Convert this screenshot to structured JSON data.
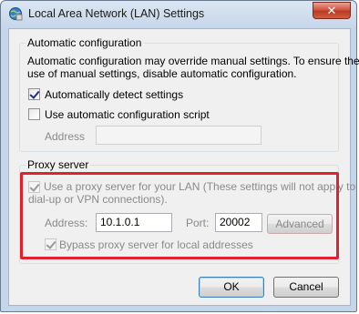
{
  "window": {
    "title": "Local Area Network (LAN) Settings",
    "close_glyph": "✕"
  },
  "auto_config": {
    "group_title": "Automatic configuration",
    "description_line1": "Automatic configuration may override manual settings.  To ensure the",
    "description_line2": "use of manual settings, disable automatic configuration.",
    "auto_detect_label": "Automatically detect settings",
    "auto_detect_checked": true,
    "use_script_label": "Use automatic configuration script",
    "use_script_checked": false,
    "address_label": "Address",
    "address_value": ""
  },
  "proxy": {
    "group_title": "Proxy server",
    "use_proxy_line1": "Use a proxy server for your LAN (These settings will not apply to",
    "use_proxy_line2": "dial-up or VPN connections).",
    "use_proxy_checked": true,
    "address_label": "Address:",
    "address_value": "10.1.0.1",
    "port_label": "Port:",
    "port_value": "20002",
    "advanced_label": "Advanced",
    "bypass_label": "Bypass proxy server for local addresses",
    "bypass_checked": true
  },
  "buttons": {
    "ok": "OK",
    "cancel": "Cancel"
  },
  "colors": {
    "highlight": "#e0222e",
    "disabled_text": "#8a8a8a"
  }
}
